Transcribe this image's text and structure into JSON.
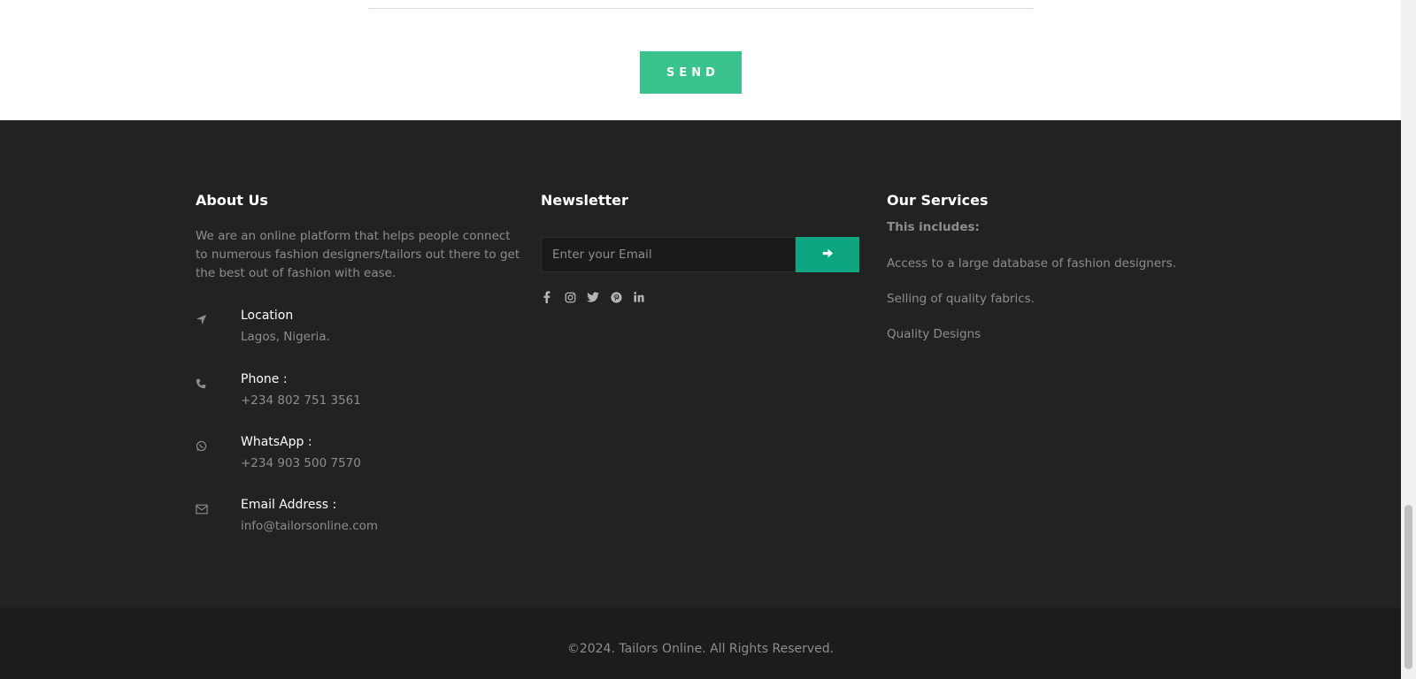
{
  "form": {
    "send_label": "SEND"
  },
  "about": {
    "title": "About Us",
    "text": "We are an online platform that helps people connect to numerous fashion designers/tailors out there to get the best out of fashion with ease.",
    "contacts": [
      {
        "icon": "location-arrow-icon",
        "label": "Location",
        "value": "Lagos, Nigeria."
      },
      {
        "icon": "phone-icon",
        "label": "Phone :",
        "value": "+234 802 751 3561"
      },
      {
        "icon": "whatsapp-icon",
        "label": "WhatsApp :",
        "value": "+234 903 500 7570"
      },
      {
        "icon": "envelope-icon",
        "label": "Email Address :",
        "value": "info@tailorsonline.com"
      }
    ]
  },
  "newsletter": {
    "title": "Newsletter",
    "placeholder": "Enter your Email",
    "social": [
      "facebook-icon",
      "instagram-icon",
      "twitter-icon",
      "pinterest-icon",
      "linkedin-icon"
    ]
  },
  "services": {
    "title": "Our Services",
    "subtitle": "This includes:",
    "items": [
      "Access to a large database of fashion designers.",
      "Selling of quality fabrics.",
      "Quality Designs"
    ]
  },
  "copyright": "©2024. Tailors Online. All Rights Reserved.",
  "colors": {
    "accent": "#3bc38e",
    "accent_dark": "#0da580",
    "footer_bg": "#222222",
    "bottom_bg": "#1c1c1c"
  }
}
